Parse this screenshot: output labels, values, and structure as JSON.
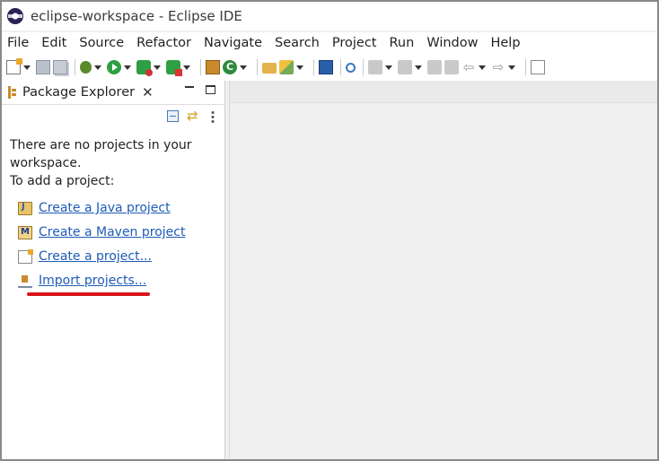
{
  "window": {
    "title": "eclipse-workspace - Eclipse IDE"
  },
  "menu": [
    "File",
    "Edit",
    "Source",
    "Refactor",
    "Navigate",
    "Search",
    "Project",
    "Run",
    "Window",
    "Help"
  ],
  "toolbar": {
    "icons": [
      "new-icon",
      "save-icon",
      "save-all-icon",
      "debug-icon",
      "run-icon",
      "coverage-icon",
      "external-tools-icon",
      "new-package-icon",
      "new-class-icon",
      "open-folder-icon",
      "tools-icon",
      "terminal-icon",
      "search-icon",
      "back-icon",
      "forward-icon",
      "maximize-icon"
    ]
  },
  "package_explorer": {
    "title": "Package Explorer",
    "empty_message": [
      "There are no projects in your",
      "workspace.",
      "To add a project:"
    ],
    "links": [
      {
        "label": "Create a Java project",
        "icon": "java-project-icon"
      },
      {
        "label": "Create a Maven project",
        "icon": "maven-project-icon"
      },
      {
        "label": "Create a project...",
        "icon": "new-project-icon"
      },
      {
        "label": "Import projects...",
        "icon": "import-projects-icon"
      }
    ]
  },
  "annotation": {
    "underline_color": "#d7141a",
    "target": "Import projects..."
  },
  "colors": {
    "link": "#1e5bb8",
    "accent": "#2c2255"
  }
}
